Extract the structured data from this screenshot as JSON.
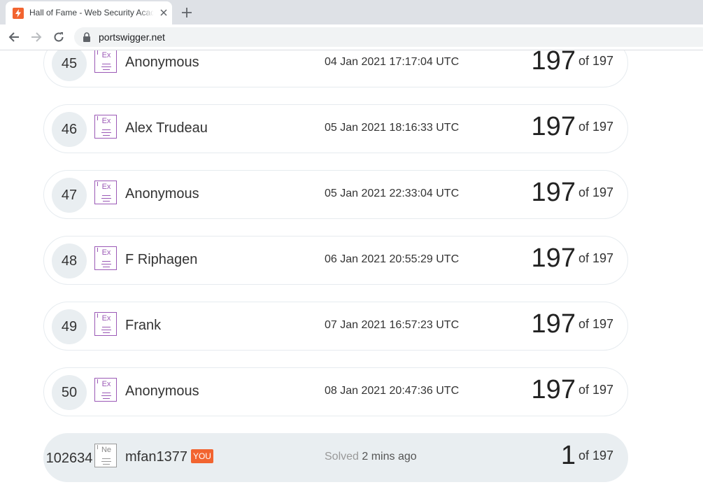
{
  "browser": {
    "tab_title": "Hall of Fame - Web Security Academy",
    "url": "portswigger.net"
  },
  "rows": [
    {
      "rank": "45",
      "badge": "Ex",
      "name": "Anonymous",
      "date": "04 Jan 2021 17:17:04 UTC",
      "score": "197",
      "of": "of 197"
    },
    {
      "rank": "46",
      "badge": "Ex",
      "name": "Alex Trudeau",
      "date": "05 Jan 2021 18:16:33 UTC",
      "score": "197",
      "of": "of 197"
    },
    {
      "rank": "47",
      "badge": "Ex",
      "name": "Anonymous",
      "date": "05 Jan 2021 22:33:04 UTC",
      "score": "197",
      "of": "of 197"
    },
    {
      "rank": "48",
      "badge": "Ex",
      "name": "F Riphagen",
      "date": "06 Jan 2021 20:55:29 UTC",
      "score": "197",
      "of": "of 197"
    },
    {
      "rank": "49",
      "badge": "Ex",
      "name": "Frank",
      "date": "07 Jan 2021 16:57:23 UTC",
      "score": "197",
      "of": "of 197"
    },
    {
      "rank": "50",
      "badge": "Ex",
      "name": "Anonymous",
      "date": "08 Jan 2021 20:47:36 UTC",
      "score": "197",
      "of": "of 197"
    }
  ],
  "you_row": {
    "rank": "102634",
    "badge": "Ne",
    "name": "mfan1377",
    "you_label": "YOU",
    "solved_label": "Solved",
    "solved_ago": "2 mins ago",
    "score": "1",
    "of": "of 197"
  },
  "colors": {
    "accent": "#f26430",
    "expert_badge": "#9b59b6",
    "rank_bg": "#e9eef1"
  }
}
